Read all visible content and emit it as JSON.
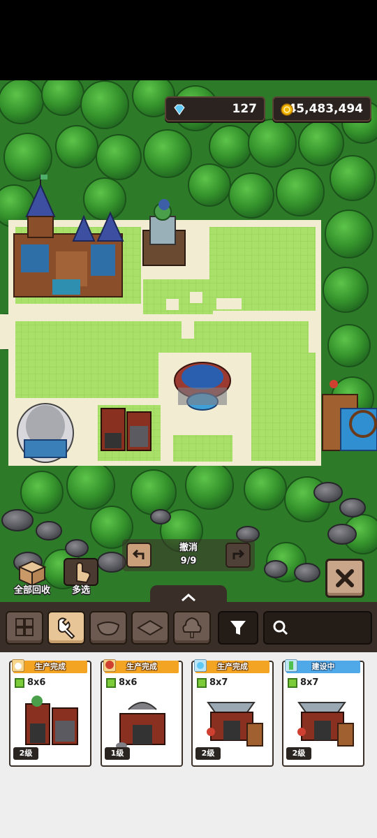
{
  "currency": {
    "gems": "127",
    "coins": "45,483,494",
    "gem_color": "#5fc8f5",
    "coin_color": "#f2b300"
  },
  "side_buttons": {
    "recycle_all": "全部回收",
    "multi_select": "多选"
  },
  "undo": {
    "label": "撤消",
    "count": "9/9"
  },
  "toolbar": {
    "categories": [
      "grid",
      "wrench",
      "bowl",
      "tile",
      "tree"
    ],
    "active_category": "wrench",
    "search_placeholder": ""
  },
  "cards": [
    {
      "status": "生产完成",
      "size": "8x6",
      "level": "2级",
      "status_color": "#f3a423"
    },
    {
      "status": "生产完成",
      "size": "8x6",
      "level": "1级",
      "status_color": "#f3a423"
    },
    {
      "status": "生产完成",
      "size": "8x7",
      "level": "2级",
      "status_color": "#f3a423"
    },
    {
      "status": "建设中",
      "size": "8x7",
      "level": "2级",
      "status_color": "#4fa8e8"
    }
  ]
}
